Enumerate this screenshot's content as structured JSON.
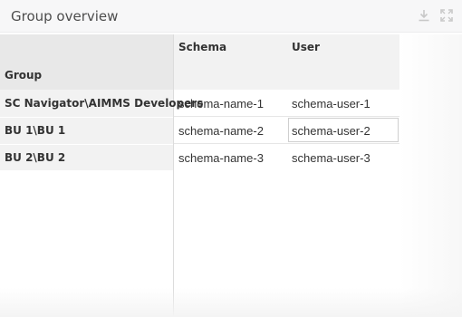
{
  "header": {
    "title": "Group overview",
    "download_icon": "download-icon",
    "fullscreen_icon": "fullscreen-icon"
  },
  "table": {
    "corner_label": "Group",
    "columns": [
      "Schema",
      "User"
    ],
    "rows": [
      {
        "group": "SC Navigator\\AIMMS Developers",
        "schema": "schema-name-1",
        "user": "schema-user-1"
      },
      {
        "group": "BU 1\\BU 1",
        "schema": "schema-name-2",
        "user": "schema-user-2"
      },
      {
        "group": "BU 2\\BU 2",
        "schema": "schema-name-3",
        "user": "schema-user-3"
      }
    ],
    "selected_cell": "schema-user-2"
  }
}
